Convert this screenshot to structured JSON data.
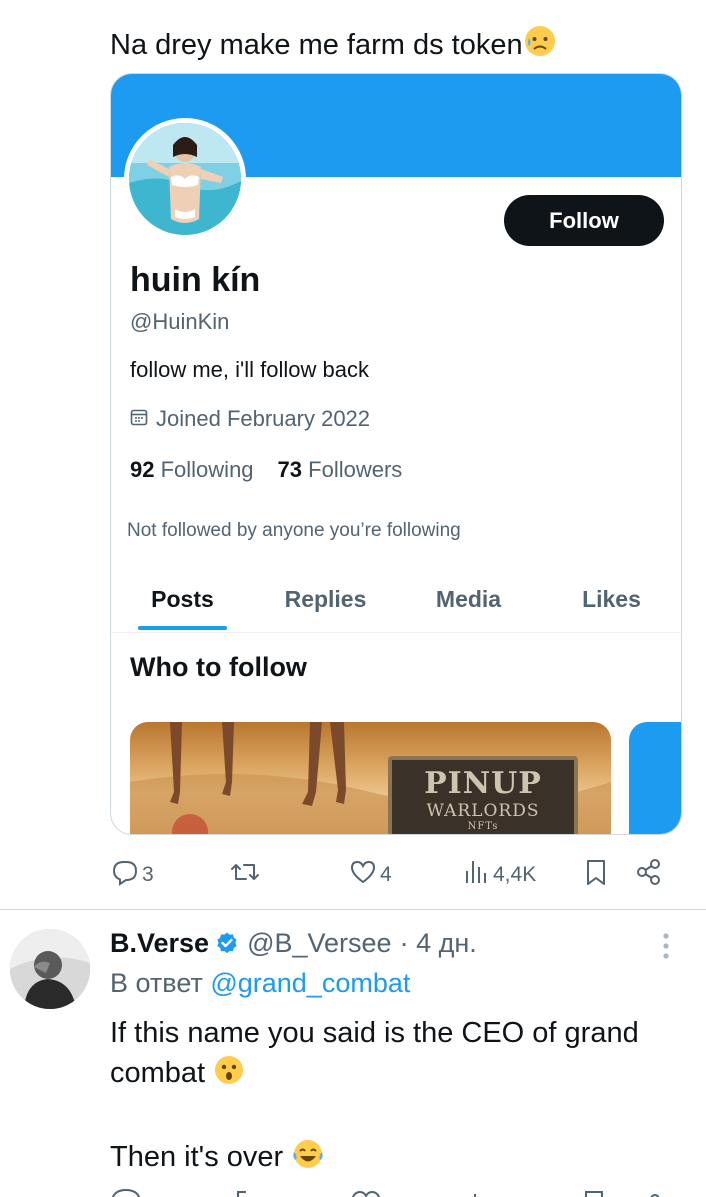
{
  "post": {
    "text": "Na drey make me farm ds token",
    "emoji_icon": "sad-sweat-emoji"
  },
  "profile_card": {
    "banner_color": "#1d9bf0",
    "follow_label": "Follow",
    "display_name": "huin kín",
    "handle": "@HuinKin",
    "bio": "follow me, i'll follow back",
    "joined": "Joined February 2022",
    "following_count": "92",
    "following_label": "Following",
    "followers_count": "73",
    "followers_label": "Followers",
    "not_followed": "Not followed by anyone you’re following",
    "tabs": [
      {
        "label": "Posts",
        "active": true
      },
      {
        "label": "Replies",
        "active": false
      },
      {
        "label": "Media",
        "active": false
      },
      {
        "label": "Likes",
        "active": false
      }
    ],
    "who_to_follow": "Who to follow",
    "promo_sign_line1": "PINUP",
    "promo_sign_line2": "WARLORDS",
    "promo_sign_line3": "NFTs"
  },
  "actions": {
    "replies": "3",
    "reposts": "",
    "likes": "4",
    "views": "4,4K"
  },
  "reply": {
    "name": "B.Verse",
    "handle": "@B_Versee",
    "time": "· 4 дн.",
    "reply_to_prefix": "В ответ",
    "reply_to_handle": "@grand_combat",
    "line1": "If this name you said is the CEO of grand combat",
    "line2": "Then it's over",
    "accent": "#1d9bf0"
  }
}
